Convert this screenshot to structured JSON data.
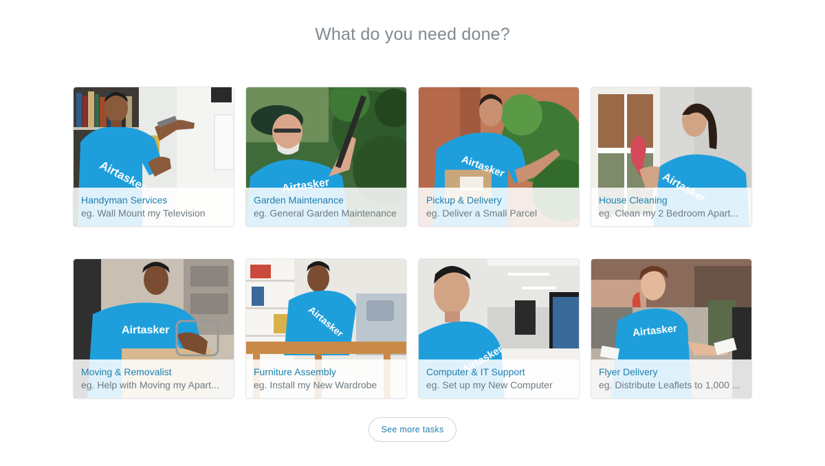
{
  "heading": "What do you need done?",
  "cards": [
    {
      "title": "Handyman Services",
      "example": "eg. Wall Mount my Television"
    },
    {
      "title": "Garden Maintenance",
      "example": "eg. General Garden Maintenance"
    },
    {
      "title": "Pickup & Delivery",
      "example": "eg. Deliver a Small Parcel"
    },
    {
      "title": "House Cleaning",
      "example": "eg. Clean my 2 Bedroom Apart..."
    },
    {
      "title": "Moving & Removalist",
      "example": "eg. Help with Moving my Apart..."
    },
    {
      "title": "Furniture Assembly",
      "example": "eg. Install my New Wardrobe"
    },
    {
      "title": "Computer & IT Support",
      "example": "eg. Set up my New Computer"
    },
    {
      "title": "Flyer Delivery",
      "example": "eg. Distribute Leaflets to 1,000 ..."
    }
  ],
  "shirt_text": "Airtasker",
  "see_more_label": "See more tasks",
  "colors": {
    "heading": "#7f8a91",
    "title_link": "#1c7faf",
    "example_text": "#6f7a80",
    "shirt_blue": "#1e9fdc"
  }
}
